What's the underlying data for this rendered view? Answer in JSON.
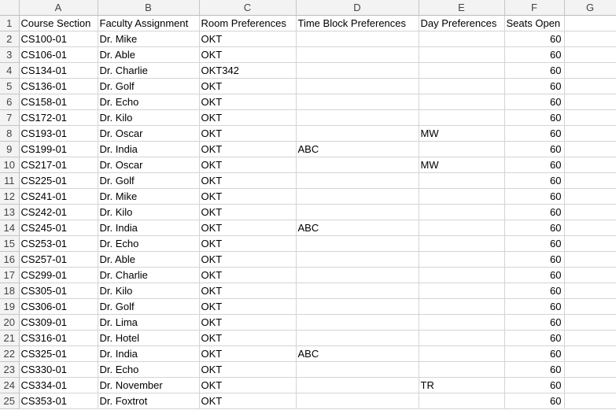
{
  "sheet": {
    "column_letters": [
      "A",
      "B",
      "C",
      "D",
      "E",
      "F",
      "G"
    ],
    "row_numbers": [
      "1",
      "2",
      "3",
      "4",
      "5",
      "6",
      "7",
      "8",
      "9",
      "10",
      "11",
      "12",
      "13",
      "14",
      "15",
      "16",
      "17",
      "18",
      "19",
      "20",
      "21",
      "22",
      "23",
      "24",
      "25"
    ],
    "headers": [
      "Course Section",
      "Faculty Assignment",
      "Room Preferences",
      "Time Block Preferences",
      "Day Preferences",
      "Seats Open",
      ""
    ],
    "rows": [
      [
        "CS100-01",
        "Dr. Mike",
        "OKT",
        "",
        "",
        "60",
        ""
      ],
      [
        "CS106-01",
        "Dr. Able",
        "OKT",
        "",
        "",
        "60",
        ""
      ],
      [
        "CS134-01",
        "Dr. Charlie",
        "OKT342",
        "",
        "",
        "60",
        ""
      ],
      [
        "CS136-01",
        "Dr. Golf",
        "OKT",
        "",
        "",
        "60",
        ""
      ],
      [
        "CS158-01",
        "Dr. Echo",
        "OKT",
        "",
        "",
        "60",
        ""
      ],
      [
        "CS172-01",
        "Dr. Kilo",
        "OKT",
        "",
        "",
        "60",
        ""
      ],
      [
        "CS193-01",
        "Dr. Oscar",
        "OKT",
        "",
        "MW",
        "60",
        ""
      ],
      [
        "CS199-01",
        "Dr. India",
        "OKT",
        "ABC",
        "",
        "60",
        ""
      ],
      [
        "CS217-01",
        "Dr. Oscar",
        "OKT",
        "",
        "MW",
        "60",
        ""
      ],
      [
        "CS225-01",
        "Dr. Golf",
        "OKT",
        "",
        "",
        "60",
        ""
      ],
      [
        "CS241-01",
        "Dr. Mike",
        "OKT",
        "",
        "",
        "60",
        ""
      ],
      [
        "CS242-01",
        "Dr. Kilo",
        "OKT",
        "",
        "",
        "60",
        ""
      ],
      [
        "CS245-01",
        "Dr. India",
        "OKT",
        "ABC",
        "",
        "60",
        ""
      ],
      [
        "CS253-01",
        "Dr. Echo",
        "OKT",
        "",
        "",
        "60",
        ""
      ],
      [
        "CS257-01",
        "Dr. Able",
        "OKT",
        "",
        "",
        "60",
        ""
      ],
      [
        "CS299-01",
        "Dr. Charlie",
        "OKT",
        "",
        "",
        "60",
        ""
      ],
      [
        "CS305-01",
        "Dr. Kilo",
        "OKT",
        "",
        "",
        "60",
        ""
      ],
      [
        "CS306-01",
        "Dr. Golf",
        "OKT",
        "",
        "",
        "60",
        ""
      ],
      [
        "CS309-01",
        "Dr. Lima",
        "OKT",
        "",
        "",
        "60",
        ""
      ],
      [
        "CS316-01",
        "Dr. Hotel",
        "OKT",
        "",
        "",
        "60",
        ""
      ],
      [
        "CS325-01",
        "Dr. India",
        "OKT",
        "ABC",
        "",
        "60",
        ""
      ],
      [
        "CS330-01",
        "Dr. Echo",
        "OKT",
        "",
        "",
        "60",
        ""
      ],
      [
        "CS334-01",
        "Dr. November",
        "OKT",
        "",
        "TR",
        "60",
        ""
      ],
      [
        "CS353-01",
        "Dr. Foxtrot",
        "OKT",
        "",
        "",
        "60",
        ""
      ]
    ]
  }
}
